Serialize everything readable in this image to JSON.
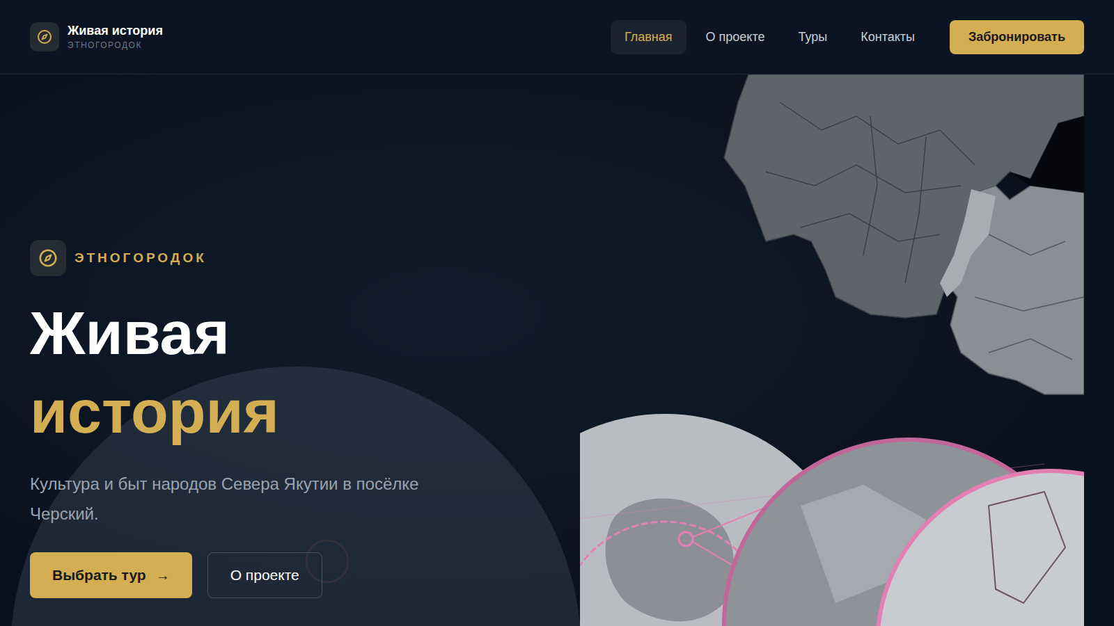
{
  "header": {
    "brand": {
      "title": "Живая история",
      "subtitle": "ЭТНОГОРОДОК"
    },
    "nav": [
      {
        "label": "Главная",
        "selected": true
      },
      {
        "label": "О проекте",
        "selected": false
      },
      {
        "label": "Туры",
        "selected": false
      },
      {
        "label": "Контакты",
        "selected": false
      }
    ],
    "book_button": "Забронировать"
  },
  "hero": {
    "badge": "ЭТНОГОРОДОК",
    "title": [
      "Живая",
      "история"
    ],
    "subtitle": "Культура и быт народов Севера Якутии в посёлке Черский.",
    "buttons": [
      {
        "label": "Выбрать тур",
        "icon": "→",
        "kind": "primary"
      },
      {
        "label": "О проекте",
        "kind": "secondary"
      }
    ]
  }
}
